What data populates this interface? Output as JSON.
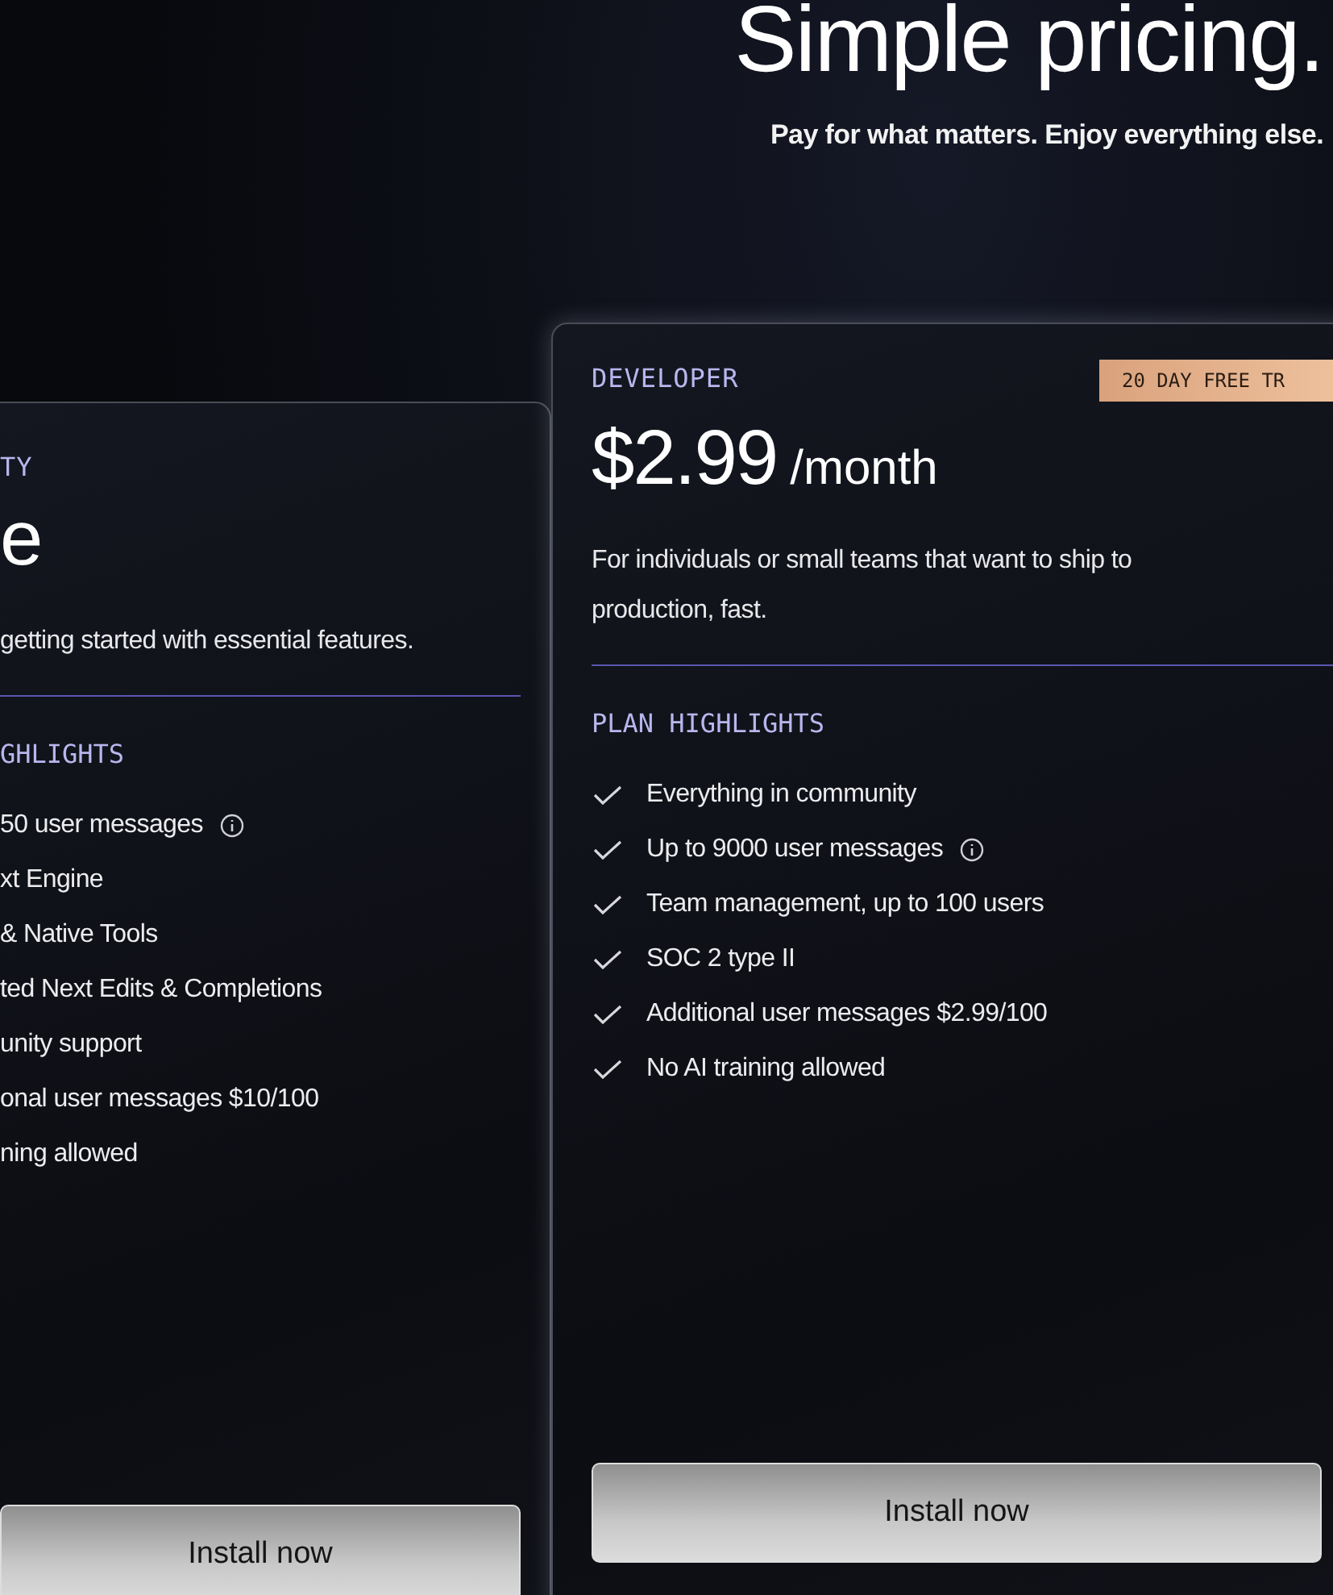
{
  "header": {
    "title": "Simple pricing.",
    "subtitle": "Pay for what matters. Enjoy everything else."
  },
  "cards": [
    {
      "tier": "TY",
      "price": "e",
      "description": "getting started with essential features.",
      "highlights_title": "GHLIGHTS",
      "show_checks": false,
      "button": "Install now",
      "features": [
        {
          "text": "50 user messages",
          "info": true
        },
        {
          "text": "xt Engine",
          "info": false
        },
        {
          "text": "& Native Tools",
          "info": false
        },
        {
          "text": "ted Next Edits & Completions",
          "info": false
        },
        {
          "text": "unity support",
          "info": false
        },
        {
          "text": "onal user messages $10/100",
          "info": false
        },
        {
          "text": "ning allowed",
          "info": false
        }
      ]
    },
    {
      "tier": "DEVELOPER",
      "price": "$2.99",
      "period": "/month",
      "badge": "20 DAY FREE TR",
      "description": "For individuals or small teams that want to ship to production, fast.",
      "highlights_title": "PLAN HIGHLIGHTS",
      "show_checks": true,
      "button": "Install now",
      "features": [
        {
          "text": "Everything in community",
          "info": false
        },
        {
          "text": "Up to 9000 user messages",
          "info": true
        },
        {
          "text": "Team management, up to 100 users",
          "info": false
        },
        {
          "text": "SOC 2 type II",
          "info": false
        },
        {
          "text": "Additional user messages $2.99/100",
          "info": false
        },
        {
          "text": "No AI training allowed",
          "info": false
        }
      ]
    }
  ]
}
